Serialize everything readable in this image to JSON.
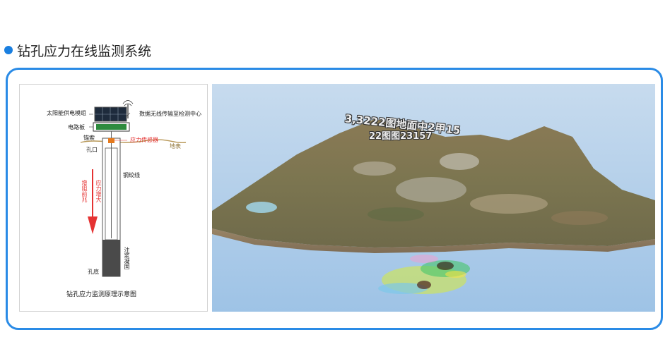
{
  "header": {
    "title": "钻孔应力在线监测系统"
  },
  "diagram": {
    "solar_label": "太阳能供电模组",
    "wireless_label": "数据无线传输至检测中心",
    "circuit_label": "电路板",
    "anchor_label": "锚索",
    "sensor_label": "应力传感器",
    "ground_label": "地表",
    "hole_mouth_label": "孔口",
    "wire_label": "钢绞线",
    "stress_increase_label": "应力增大",
    "precursor_label": "增阻前兆",
    "grout_label": "注浆凝固",
    "hole_bottom_label": "孔底",
    "caption": "钻孔应力监测原理示意图"
  },
  "scene": {
    "overlay_line1": "3,3222图地面中2甲15",
    "overlay_line2": "22图图23157"
  },
  "colors": {
    "accent": "#2a8be6",
    "dot": "#1a7fe0",
    "sensor_red": "#e53333"
  }
}
